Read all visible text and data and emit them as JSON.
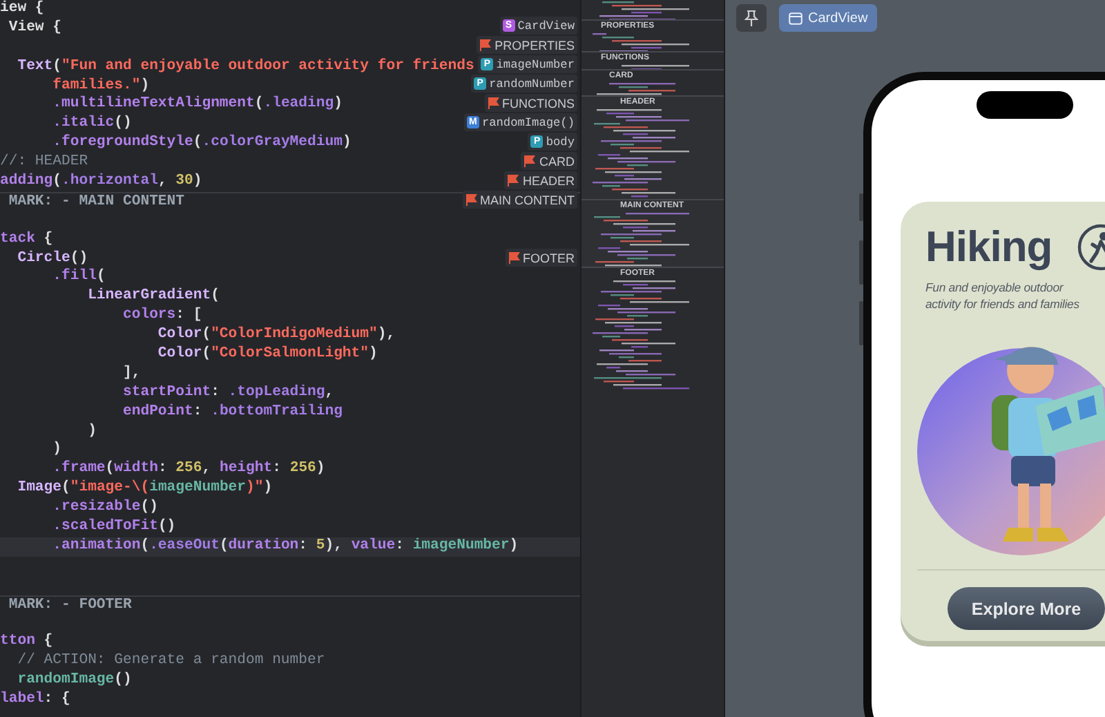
{
  "editor": {
    "lines": [
      {
        "current": false,
        "segments": [
          {
            "kind": "plain",
            "text": "iew {"
          }
        ]
      },
      {
        "current": false,
        "segments": [
          {
            "kind": "plain",
            "text": " View {"
          }
        ]
      },
      {
        "current": false
      },
      {
        "current": false,
        "segments": [
          {
            "kind": "type",
            "text": "  Text"
          },
          {
            "kind": "plain",
            "text": "("
          },
          {
            "kind": "string",
            "text": "\"Fun and enjoyable outdoor activity for friends"
          }
        ]
      },
      {
        "current": false,
        "segments": [
          {
            "kind": "string",
            "text": "      families.\""
          },
          {
            "kind": "plain",
            "text": ")"
          }
        ]
      },
      {
        "current": false,
        "segments": [
          {
            "kind": "method",
            "text": "      .multilineTextAlignment"
          },
          {
            "kind": "plain",
            "text": "("
          },
          {
            "kind": "member",
            "text": ".leading"
          },
          {
            "kind": "plain",
            "text": ")"
          }
        ]
      },
      {
        "current": false,
        "segments": [
          {
            "kind": "method",
            "text": "      .italic"
          },
          {
            "kind": "plain",
            "text": "()"
          }
        ]
      },
      {
        "current": false,
        "segments": [
          {
            "kind": "method",
            "text": "      .foregroundStyle"
          },
          {
            "kind": "plain",
            "text": "("
          },
          {
            "kind": "member",
            "text": ".colorGrayMedium"
          },
          {
            "kind": "plain",
            "text": ")"
          }
        ]
      },
      {
        "current": false,
        "segments": [
          {
            "kind": "comment",
            "text": "//: HEADER"
          }
        ]
      },
      {
        "current": false,
        "segments": [
          {
            "kind": "method",
            "text": "adding"
          },
          {
            "kind": "plain",
            "text": "("
          },
          {
            "kind": "member",
            "text": ".horizontal"
          },
          {
            "kind": "plain",
            "text": ", "
          },
          {
            "kind": "number",
            "text": "30"
          },
          {
            "kind": "plain",
            "text": ")"
          }
        ]
      },
      {
        "current": false,
        "segments": [
          {
            "kind": "mark",
            "text": " MARK: - MAIN CONTENT"
          }
        ]
      },
      {
        "current": false
      },
      {
        "current": false,
        "segments": [
          {
            "kind": "method",
            "text": "tack"
          },
          {
            "kind": "plain",
            "text": " {"
          }
        ]
      },
      {
        "current": false,
        "segments": [
          {
            "kind": "type",
            "text": "  Circle"
          },
          {
            "kind": "plain",
            "text": "()"
          }
        ]
      },
      {
        "current": false,
        "segments": [
          {
            "kind": "method",
            "text": "      .fill"
          },
          {
            "kind": "plain",
            "text": "("
          }
        ]
      },
      {
        "current": false,
        "segments": [
          {
            "kind": "type",
            "text": "          LinearGradient"
          },
          {
            "kind": "plain",
            "text": "("
          }
        ]
      },
      {
        "current": false,
        "segments": [
          {
            "kind": "method",
            "text": "              colors"
          },
          {
            "kind": "plain",
            "text": ": ["
          }
        ]
      },
      {
        "current": false,
        "segments": [
          {
            "kind": "type",
            "text": "                  Color"
          },
          {
            "kind": "plain",
            "text": "("
          },
          {
            "kind": "string",
            "text": "\"ColorIndigoMedium\""
          },
          {
            "kind": "plain",
            "text": "),"
          }
        ]
      },
      {
        "current": false,
        "segments": [
          {
            "kind": "type",
            "text": "                  Color"
          },
          {
            "kind": "plain",
            "text": "("
          },
          {
            "kind": "string",
            "text": "\"ColorSalmonLight\""
          },
          {
            "kind": "plain",
            "text": ")"
          }
        ]
      },
      {
        "current": false,
        "segments": [
          {
            "kind": "plain",
            "text": "              ],"
          }
        ]
      },
      {
        "current": false,
        "segments": [
          {
            "kind": "method",
            "text": "              startPoint"
          },
          {
            "kind": "plain",
            "text": ": "
          },
          {
            "kind": "member",
            "text": ".topLeading"
          },
          {
            "kind": "plain",
            "text": ","
          }
        ]
      },
      {
        "current": false,
        "segments": [
          {
            "kind": "method",
            "text": "              endPoint"
          },
          {
            "kind": "plain",
            "text": ": "
          },
          {
            "kind": "member",
            "text": ".bottomTrailing"
          }
        ]
      },
      {
        "current": false,
        "segments": [
          {
            "kind": "plain",
            "text": "          )"
          }
        ]
      },
      {
        "current": false,
        "segments": [
          {
            "kind": "plain",
            "text": "      )"
          }
        ]
      },
      {
        "current": false,
        "segments": [
          {
            "kind": "method",
            "text": "      .frame"
          },
          {
            "kind": "plain",
            "text": "("
          },
          {
            "kind": "method",
            "text": "width"
          },
          {
            "kind": "plain",
            "text": ": "
          },
          {
            "kind": "number",
            "text": "256"
          },
          {
            "kind": "plain",
            "text": ", "
          },
          {
            "kind": "method",
            "text": "height"
          },
          {
            "kind": "plain",
            "text": ": "
          },
          {
            "kind": "number",
            "text": "256"
          },
          {
            "kind": "plain",
            "text": ")"
          }
        ]
      },
      {
        "current": false,
        "segments": [
          {
            "kind": "type",
            "text": "  Image"
          },
          {
            "kind": "plain",
            "text": "("
          },
          {
            "kind": "string",
            "text": "\"image-\\("
          },
          {
            "kind": "project",
            "text": "imageNumber"
          },
          {
            "kind": "string",
            "text": ")\""
          },
          {
            "kind": "plain",
            "text": ")"
          }
        ]
      },
      {
        "current": false,
        "segments": [
          {
            "kind": "method",
            "text": "      .resizable"
          },
          {
            "kind": "plain",
            "text": "()"
          }
        ]
      },
      {
        "current": false,
        "segments": [
          {
            "kind": "method",
            "text": "      .scaledToFit"
          },
          {
            "kind": "plain",
            "text": "()"
          }
        ]
      },
      {
        "current": true,
        "segments": [
          {
            "kind": "method",
            "text": "      .animation"
          },
          {
            "kind": "plain",
            "text": "("
          },
          {
            "kind": "member",
            "text": ".easeOut"
          },
          {
            "kind": "plain",
            "text": "("
          },
          {
            "kind": "method",
            "text": "duration"
          },
          {
            "kind": "plain",
            "text": ": "
          },
          {
            "kind": "number",
            "text": "5"
          },
          {
            "kind": "plain",
            "text": "), "
          },
          {
            "kind": "method",
            "text": "value"
          },
          {
            "kind": "plain",
            "text": ": "
          },
          {
            "kind": "project",
            "text": "imageNumber"
          },
          {
            "kind": "plain",
            "text": ")"
          }
        ]
      },
      {
        "current": false
      },
      {
        "current": false
      },
      {
        "current": false,
        "segments": [
          {
            "kind": "mark",
            "text": " MARK: - FOOTER"
          }
        ]
      },
      {
        "current": false
      },
      {
        "current": false,
        "segments": [
          {
            "kind": "method",
            "text": "tton"
          },
          {
            "kind": "plain",
            "text": " {"
          }
        ]
      },
      {
        "current": false,
        "segments": [
          {
            "kind": "comment",
            "text": "  // ACTION: Generate a random number"
          }
        ]
      },
      {
        "current": false,
        "segments": [
          {
            "kind": "project",
            "text": "  randomImage"
          },
          {
            "kind": "plain",
            "text": "()"
          }
        ]
      },
      {
        "current": false,
        "segments": [
          {
            "kind": "method",
            "text": "label"
          },
          {
            "kind": "plain",
            "text": ": {"
          }
        ]
      }
    ],
    "outline": [
      {
        "kind": "struct",
        "icon": "S",
        "label": "CardView"
      },
      {
        "kind": "mark",
        "label": "PROPERTIES"
      },
      {
        "kind": "property",
        "icon": "P",
        "label": "imageNumber"
      },
      {
        "kind": "property",
        "icon": "P",
        "label": "randomNumber"
      },
      {
        "kind": "mark",
        "label": "FUNCTIONS"
      },
      {
        "kind": "method",
        "icon": "M",
        "label": "randomImage()"
      },
      {
        "kind": "property",
        "icon": "P",
        "label": "body"
      },
      {
        "kind": "mark",
        "label": "CARD"
      },
      {
        "kind": "mark",
        "label": "HEADER"
      },
      {
        "kind": "mark",
        "label": "MAIN CONTENT"
      },
      {
        "kind": "mark",
        "label": "FOOTER"
      }
    ]
  },
  "minimap": {
    "sections": [
      {
        "label": "PROPERTIES"
      },
      {
        "label": "FUNCTIONS"
      },
      {
        "label": "CARD"
      },
      {
        "label": "HEADER"
      },
      {
        "label": "MAIN CONTENT"
      },
      {
        "label": "FOOTER"
      }
    ]
  },
  "preview": {
    "toolbar": {
      "label": "CardView"
    },
    "card": {
      "title": "Hiking",
      "subtitle": "Fun and enjoyable outdoor activity for friends and families",
      "button": "Explore More"
    }
  }
}
